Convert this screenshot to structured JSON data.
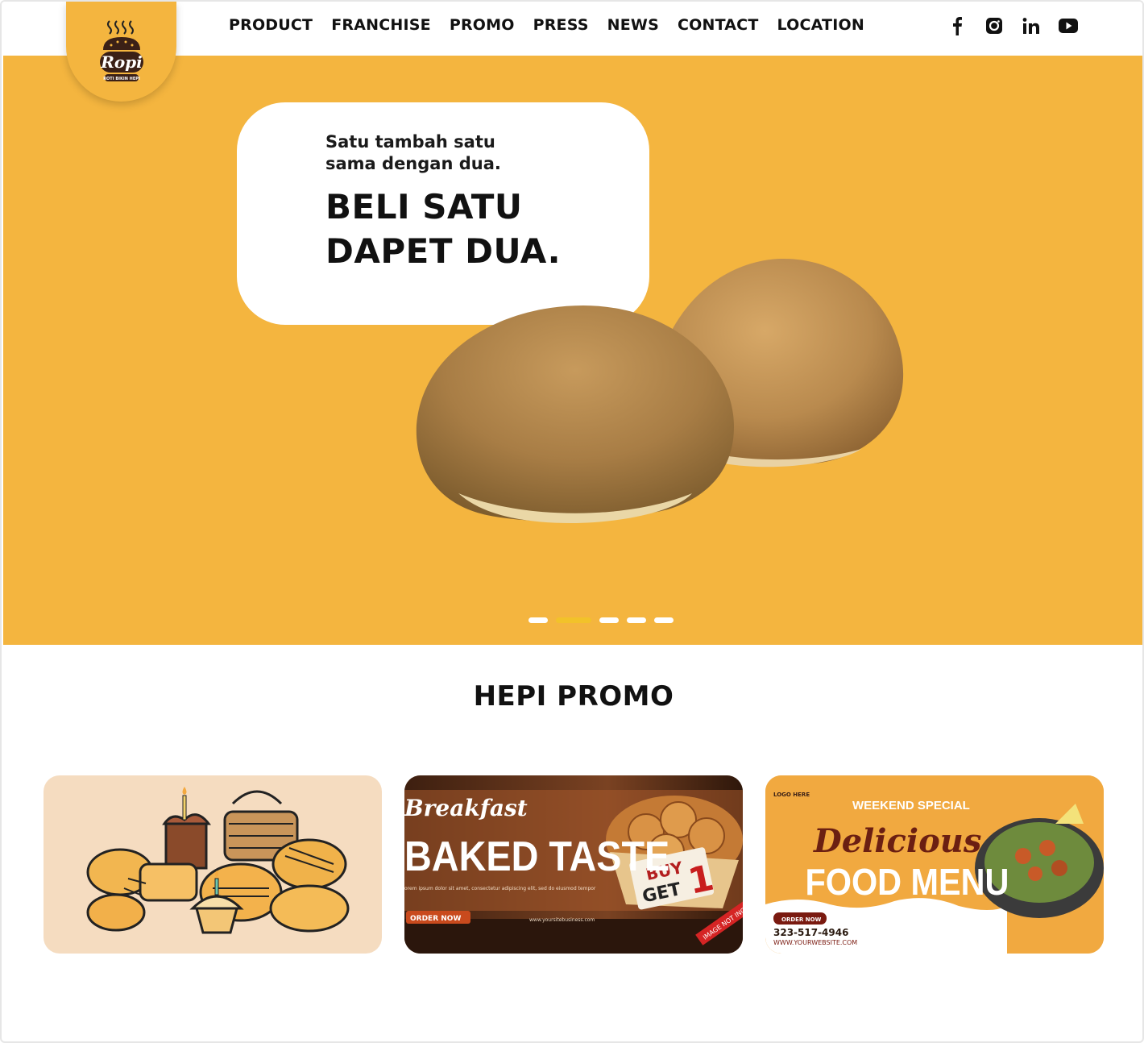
{
  "brand": {
    "logo_text": "Ropi",
    "logo_subtext": "ROTI BIKIN HEPI"
  },
  "nav": {
    "items": [
      "PRODUCT",
      "FRANCHISE",
      "PROMO",
      "PRESS",
      "NEWS",
      "CONTACT",
      "LOCATION"
    ]
  },
  "social": [
    "facebook-icon",
    "instagram-icon",
    "linkedin-icon",
    "youtube-icon"
  ],
  "hero": {
    "tagline_line1": "Satu tambah satu",
    "tagline_line2": "sama dengan dua.",
    "headline_line1": "BELI SATU",
    "headline_line2": "DAPET DUA.",
    "slides_total": 5,
    "active_slide": 2
  },
  "promo": {
    "title": "HEPI PROMO",
    "cards": [
      {
        "kind": "illustration"
      },
      {
        "script_title": "Breakfast",
        "title": "BAKED TASTE",
        "badge_line1": "BUY",
        "badge_line2": "GET",
        "badge_number": "1",
        "cta": "ORDER NOW",
        "body": "orem ipsum dolor sit amet, consectetur adipiscing elit, sed do eiusmod tempor",
        "website": "www.yoursitebusiness.com",
        "ribbon": "IMAGE NOT INCL"
      },
      {
        "logo": "LOGO HERE",
        "kicker": "WEEKEND SPECIAL",
        "script_title": "Delicious",
        "title": "FOOD MENU",
        "cta": "ORDER NOW",
        "phone": "323-517-4946",
        "website": "WWW.YOURWEBSITE.COM"
      }
    ]
  },
  "colors": {
    "brand_yellow": "#f4b53f",
    "dot_active": "#f2c22a",
    "text_dark": "#111111"
  }
}
